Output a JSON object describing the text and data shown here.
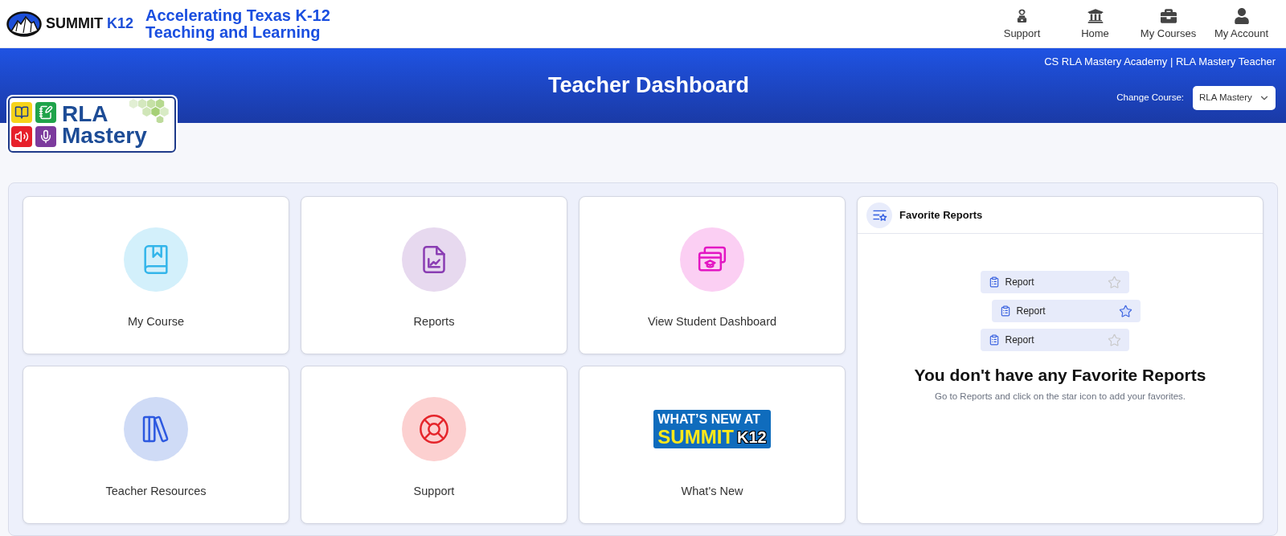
{
  "header": {
    "brand": {
      "name": "SUMMIT",
      "suffix": "K12"
    },
    "tagline": [
      "Accelerating Texas K-12",
      "Teaching and Learning"
    ],
    "nav": [
      {
        "label": "Support"
      },
      {
        "label": "Home"
      },
      {
        "label": "My Courses"
      },
      {
        "label": "My Account"
      }
    ]
  },
  "banner": {
    "title": "Teacher Dashboard",
    "user": "CS RLA Mastery Academy | RLA Mastery Teacher",
    "change_course": {
      "label": "Change Course:",
      "value": "RLA Mastery"
    }
  },
  "course_logo": {
    "lines": [
      "RLA",
      "Mastery"
    ]
  },
  "tiles": [
    {
      "kind": "icon",
      "label": "My Course"
    },
    {
      "kind": "icon",
      "label": "Reports"
    },
    {
      "kind": "icon",
      "label": "View Student Dashboard"
    },
    {
      "kind": "icon",
      "label": "Teacher Resources"
    },
    {
      "kind": "icon",
      "label": "Support"
    },
    {
      "kind": "banner",
      "label": "What's New",
      "banner": {
        "line_1": "WHAT’S NEW AT",
        "line_2": "SUMMIT",
        "badge": "K12"
      }
    }
  ],
  "favorite_reports": {
    "title": "Favorite Reports",
    "sample_rows": [
      {
        "label": "Report",
        "starred": false
      },
      {
        "label": "Report",
        "starred": true
      },
      {
        "label": "Report",
        "starred": false
      }
    ],
    "heading": "You don't have any Favorite Reports",
    "message": "Go to Reports and click on the star icon to add your favorites."
  }
}
